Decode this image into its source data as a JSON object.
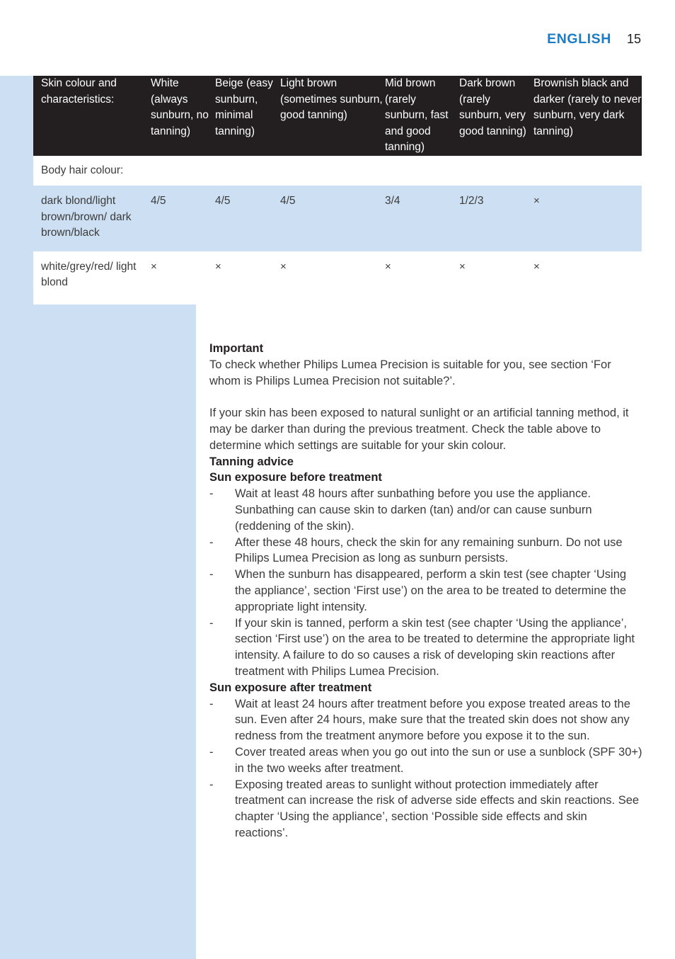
{
  "header": {
    "language": "ENGLISH",
    "page_number": "15"
  },
  "table": {
    "columns": [
      "Skin colour and characteristics:",
      "White (always sunburn, no tanning)",
      "Beige (easy sunburn, minimal tanning)",
      "Light brown (sometimes sunburn, good tanning)",
      "Mid brown (rarely sunburn, fast and good tanning)",
      "Dark brown (rarely sunburn, very good tanning)",
      "Brownish black and darker (rarely to never sunburn, very dark tanning)"
    ],
    "section_label": "Body hair colour:",
    "rows": [
      {
        "label": "dark blond/light brown/brown/ dark brown/black",
        "values": [
          "4/5",
          "4/5",
          "4/5",
          "3/4",
          "1/2/3",
          "×"
        ]
      },
      {
        "label": "white/grey/red/ light blond",
        "values": [
          "×",
          "×",
          "×",
          "×",
          "×",
          "×"
        ]
      }
    ]
  },
  "content": {
    "important_heading": "Important",
    "important_para_1": "To check whether Philips Lumea Precision is suitable for you, see section ‘For whom is Philips Lumea Precision not suitable?’.",
    "important_para_2": "If your skin has been exposed to natural sunlight or an artificial tanning method, it may be darker than during the previous treatment. Check the table above to determine which settings are suitable for your skin colour.",
    "tanning_heading": "Tanning advice",
    "before_heading": "Sun exposure before treatment",
    "before_bullets": [
      "Wait at least 48 hours after sunbathing before you use the appliance. Sunbathing can cause skin to darken (tan) and/or can cause sunburn (reddening of the skin).",
      "After these 48 hours, check the skin for any remaining sunburn. Do not use Philips Lumea Precision as long as sunburn persists.",
      "When the sunburn has disappeared, perform a skin test (see chapter ‘Using the appliance’, section ‘First use’) on the area to be treated to determine the appropriate light intensity.",
      "If your skin is tanned, perform a skin test (see chapter ‘Using the appliance’, section ‘First use’) on the area to be treated to determine the appropriate light intensity. A failure to do so causes a risk of developing skin reactions after treatment with Philips Lumea Precision."
    ],
    "after_heading": "Sun exposure after treatment",
    "after_bullets": [
      "Wait at least 24 hours after treatment before you expose treated areas to the sun. Even after 24 hours, make sure that the treated skin does not show any redness from the treatment anymore before you expose it to the sun.",
      "Cover treated areas when you go out into the sun or use a sunblock (SPF 30+) in the two weeks after treatment.",
      "Exposing treated areas to sunlight without protection immediately after treatment can increase the risk of adverse side effects and skin reactions. See chapter ‘Using the appliance’, section ‘Possible side effects and skin reactions’."
    ],
    "bullet_marker": "-"
  },
  "colors": {
    "accent_blue": "#1b7dc4",
    "panel_blue": "#cddff2",
    "table_header_dark": "#231f20",
    "body_text": "#3b3b3b"
  }
}
